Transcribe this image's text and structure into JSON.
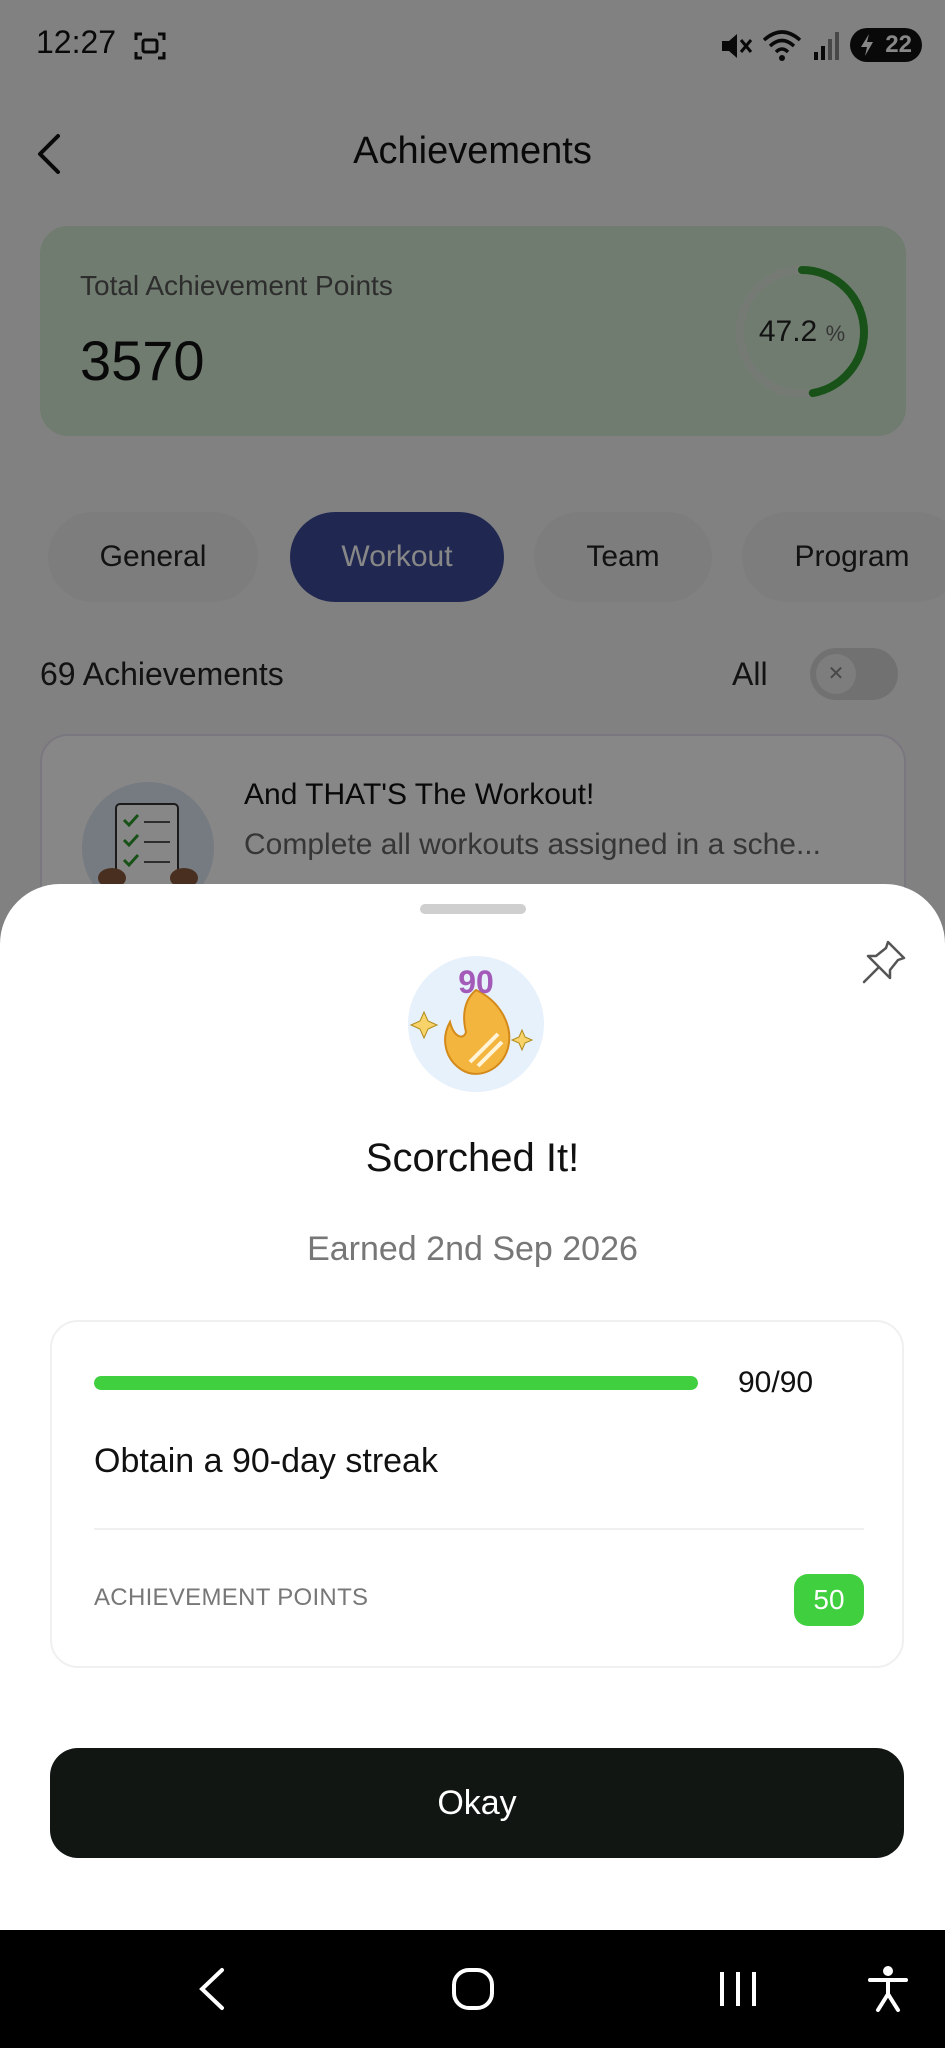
{
  "status_bar": {
    "time": "12:27",
    "battery": "22",
    "icons": [
      "screenshot-icon",
      "mute-icon",
      "wifi-icon",
      "signal-icon",
      "battery-charging-icon"
    ]
  },
  "header": {
    "title": "Achievements",
    "back_icon": "back-chevron-icon"
  },
  "summary": {
    "label": "Total Achievement Points",
    "points": "3570",
    "ring_value": "47.2",
    "ring_unit": "%",
    "ring_fraction": 0.472,
    "ring_color": "#2e9b2e"
  },
  "tabs": [
    {
      "label": "General",
      "active": false
    },
    {
      "label": "Workout",
      "active": true
    },
    {
      "label": "Team",
      "active": false
    },
    {
      "label": "Program",
      "active": false
    }
  ],
  "list": {
    "count_label": "69 Achievements",
    "filter_label": "All",
    "toggle_on": false,
    "items": [
      {
        "title": "And THAT'S The Workout!",
        "description": "Complete all workouts assigned in a sche..."
      }
    ]
  },
  "sheet": {
    "pin_icon": "pin-icon",
    "badge_number": "90",
    "badge_icon": "flame-badge-icon",
    "title": "Scorched It!",
    "earned": "Earned 2nd Sep 2026",
    "progress_text": "90/90",
    "progress_fraction": 1.0,
    "description": "Obtain a 90-day streak",
    "points_label": "ACHIEVEMENT POINTS",
    "points_value": "50",
    "okay_label": "Okay",
    "accent_color": "#3fcf3f"
  },
  "nav_bar": {
    "icons": [
      "nav-back-icon",
      "nav-home-icon",
      "nav-recents-icon",
      "accessibility-icon"
    ]
  }
}
